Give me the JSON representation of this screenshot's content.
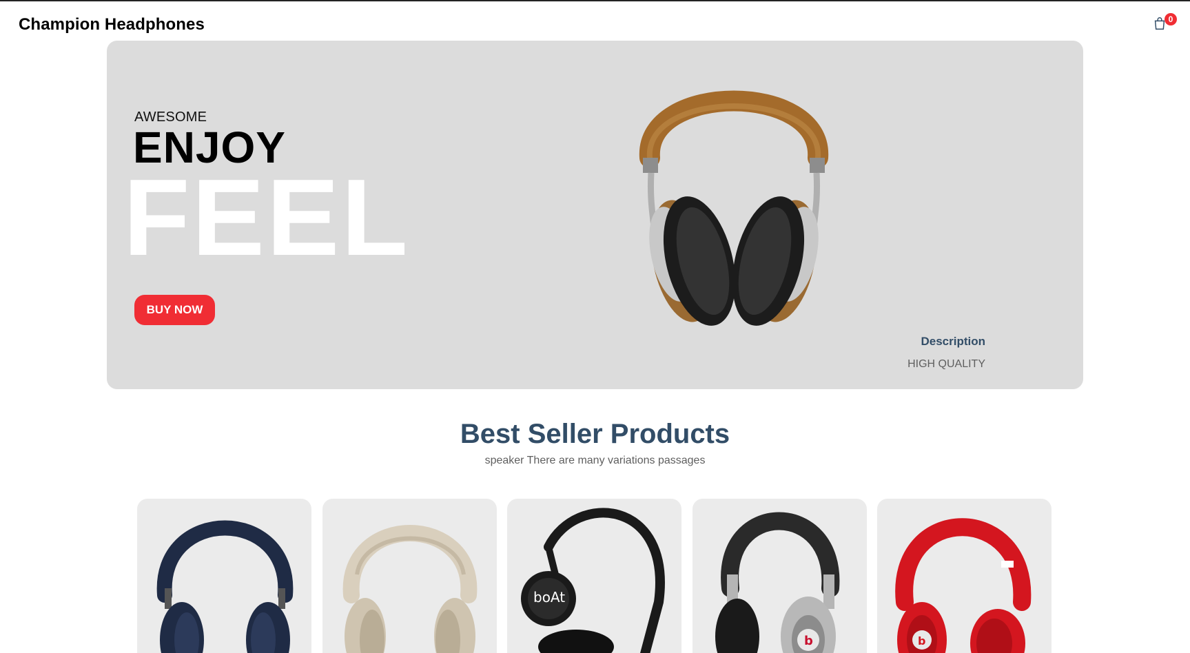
{
  "navbar": {
    "logo": "Champion Headphones",
    "cart_count": "0"
  },
  "hero": {
    "small_text": "AWESOME",
    "mid_text": "ENJOY",
    "large_text": "FEEL",
    "button_label": "BUY NOW",
    "desc_title": "Description",
    "desc_text": "HIGH QUALITY"
  },
  "best_sellers": {
    "title": "Best Seller Products",
    "subtitle": "speaker There are many variations passages"
  },
  "products": [
    {
      "icon": "headphones-navy-icon",
      "color": "#1f2b45"
    },
    {
      "icon": "headphones-beige-icon",
      "color": "#d9cfbd"
    },
    {
      "icon": "headphones-boat-icon",
      "color": "#1a1a1a",
      "brand": "boAt"
    },
    {
      "icon": "headphones-beats-pro-icon",
      "color": "#2a2a2a"
    },
    {
      "icon": "headphones-beats-red-icon",
      "color": "#d4161f"
    }
  ],
  "colors": {
    "accent": "#f02d34",
    "heading": "#324d67",
    "hero_bg": "#dcdcdc",
    "card_bg": "#ebebeb"
  }
}
